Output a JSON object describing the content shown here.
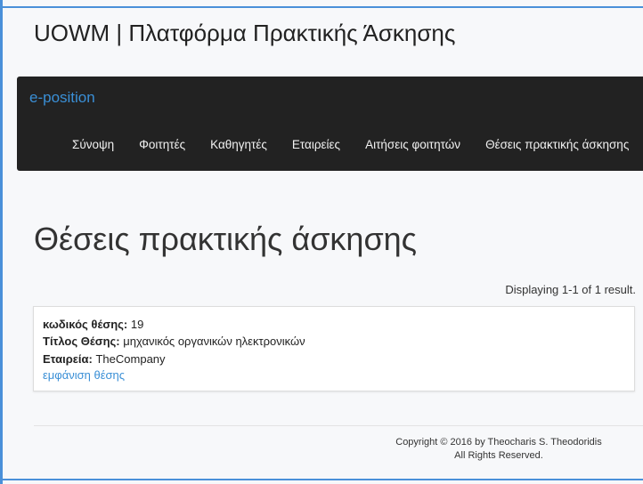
{
  "header": {
    "title": "UOWM | Πλατφόρμα Πρακτικής Άσκησης"
  },
  "navbar": {
    "brand": "e-position",
    "items": [
      "Σύνοψη",
      "Φοιτητές",
      "Καθηγητές",
      "Εταιρείες",
      "Αιτήσεις φοιτητών",
      "Θέσεις πρακτικής άσκησης"
    ]
  },
  "main": {
    "heading": "Θέσεις πρακτικής άσκησης",
    "summary": "Displaying 1-1 of 1 result.",
    "position": {
      "code_label": "κωδικός θέσης:",
      "code": "19",
      "title_label": "Τίτλος Θέσης:",
      "title": "μηχανικός οργανικών ηλεκτρονικών",
      "company_label": "Εταιρεία:",
      "company": "TheCompany",
      "view_link": "εμφάνιση θέσης"
    }
  },
  "footer": {
    "copyright": "Copyright © 2016 by Theocharis S. Theodoridis",
    "rights": "All Rights Reserved."
  },
  "colors": {
    "accent": "#3a8fd6",
    "navbar_bg": "#222222",
    "page_bg": "#f7f8fa"
  }
}
